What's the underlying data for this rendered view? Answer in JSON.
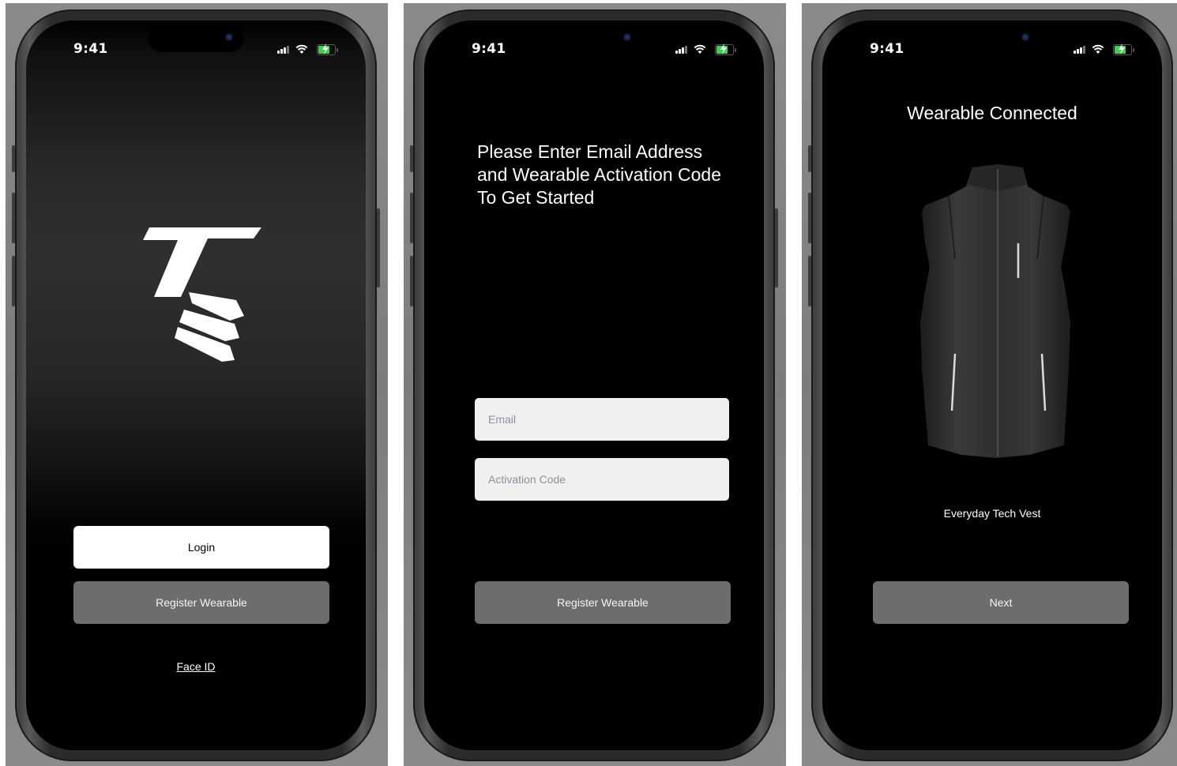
{
  "status_bar": {
    "time": "9:41"
  },
  "screens": [
    {
      "id": "login",
      "login_label": "Login",
      "register_label": "Register Wearable",
      "face_id_label": "Face ID"
    },
    {
      "id": "register",
      "headline_lines": [
        "Please Enter Email Address",
        "and Wearable Activation Code",
        "To Get Started"
      ],
      "email_placeholder": "Email",
      "activation_placeholder": "Activation Code",
      "register_label": "Register Wearable"
    },
    {
      "id": "connected",
      "title": "Wearable Connected",
      "product_name": "Everyday Tech Vest",
      "next_label": "Next"
    }
  ],
  "colors": {
    "primary_button": "#ffffff",
    "secondary_button": "#6d6d6f",
    "screen_background": "#000000",
    "battery": "#3cd055"
  },
  "icons": [
    "cellular-signal-icon",
    "wifi-icon",
    "battery-charging-icon",
    "brand-logo"
  ]
}
